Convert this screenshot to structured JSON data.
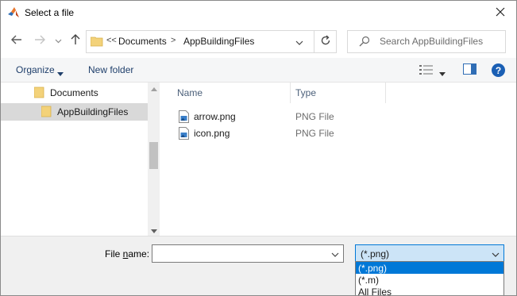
{
  "window": {
    "title": "Select a file"
  },
  "icons": {
    "app": "matlab-logo-icon",
    "close": "close-icon",
    "back": "arrow-left-icon",
    "forward": "arrow-right-icon",
    "recent": "chevron-down-icon",
    "up": "arrow-up-icon",
    "refresh": "refresh-icon",
    "search": "search-icon",
    "folder": "folder-icon",
    "help": "help-icon"
  },
  "address": {
    "overflow": "<<",
    "segments": [
      "Documents",
      "AppBuildingFiles"
    ],
    "separator": ">"
  },
  "search": {
    "placeholder": "Search AppBuildingFiles"
  },
  "toolbar": {
    "organize": "Organize",
    "new_folder": "New folder",
    "help": "?"
  },
  "navpane": {
    "items": [
      {
        "label": "Documents",
        "selected": false
      },
      {
        "label": "AppBuildingFiles",
        "selected": true
      }
    ]
  },
  "filelist": {
    "columns": {
      "name": "Name",
      "type": "Type"
    },
    "files": [
      {
        "name": "arrow.png",
        "type": "PNG File"
      },
      {
        "name": "icon.png",
        "type": "PNG File"
      }
    ]
  },
  "bottom": {
    "filename_label_pre": "File ",
    "filename_label_ul": "n",
    "filename_label_post": "ame:",
    "filename_value": "",
    "filter_value": "(*.png)",
    "filter_options": [
      "(*.png)",
      "(*.m)",
      "All Files"
    ],
    "filter_selected_index": 0
  },
  "colors": {
    "accent": "#0078d7",
    "selection_bg": "#cce4f7",
    "nav_selected": "#d9d9d9"
  }
}
